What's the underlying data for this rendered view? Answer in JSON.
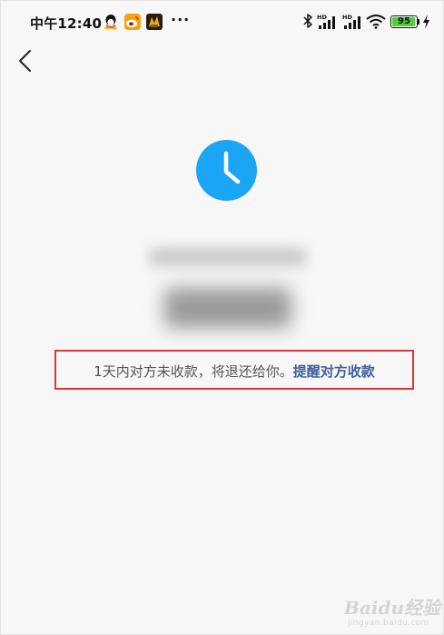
{
  "status_bar": {
    "time": "中午12:40",
    "more": "···",
    "battery_level": "95",
    "battery_fraction": 0.95,
    "network_label": "HD"
  },
  "nav": {
    "back_icon": "chevron-left-icon"
  },
  "status": {
    "icon": "clock-icon",
    "accent_color": "#1aa5f5"
  },
  "notice": {
    "text": "1天内对方未收款，将退还给你。",
    "action": "提醒对方收款",
    "highlight_color": "#d63b3b"
  },
  "watermark": {
    "brand": "Baidu经验",
    "sub": "jingyan.baidu.com"
  }
}
